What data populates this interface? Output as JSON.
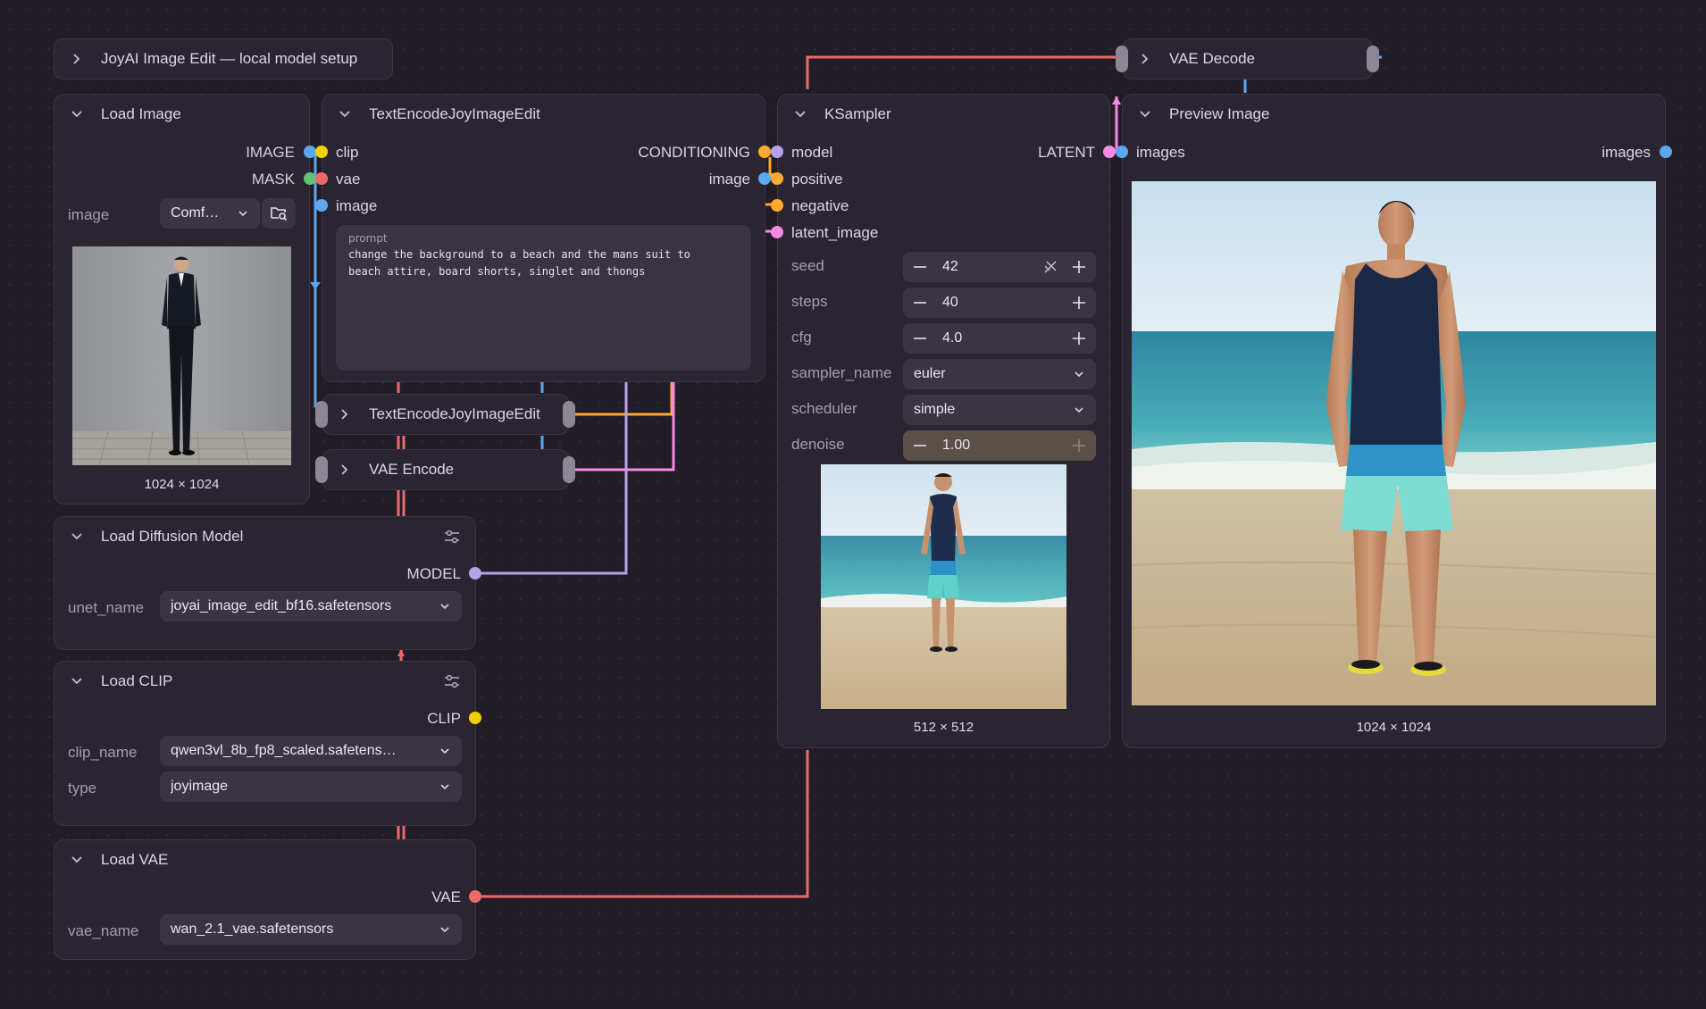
{
  "colors": {
    "background": "#211c26",
    "node_bg": "#2b2532",
    "image": "#5aa8f0",
    "clip": "#f2d000",
    "vae": "#ee6a6a",
    "model": "#b7a2ea",
    "conditioning": "#ffa931",
    "latent": "#f58ae0",
    "mask": "#5ec476"
  },
  "group_node": {
    "title": "JoyAI Image Edit — local model setup"
  },
  "load_image": {
    "title": "Load Image",
    "outputs": [
      "IMAGE",
      "MASK"
    ],
    "widget_label": "image",
    "select_value": "Comf…",
    "folder_icon": "folder-search-icon",
    "preview_caption": "1024 × 1024"
  },
  "text_encode": {
    "title": "TextEncodeJoyImageEdit",
    "inputs": [
      "clip",
      "vae",
      "image"
    ],
    "outputs": [
      "CONDITIONING",
      "image"
    ],
    "prompt_label": "prompt",
    "prompt_text": "change the background to a beach and the mans suit to\nbeach attire, board shorts, singlet and thongs"
  },
  "text_encode_collapsed": {
    "title": "TextEncodeJoyImageEdit"
  },
  "vae_encode": {
    "title": "VAE Encode"
  },
  "vae_decode": {
    "title": "VAE Decode"
  },
  "ksampler": {
    "title": "KSampler",
    "inputs": [
      "model",
      "positive",
      "negative",
      "latent_image"
    ],
    "output": "LATENT",
    "widgets": {
      "seed": {
        "label": "seed",
        "value": "42"
      },
      "steps": {
        "label": "steps",
        "value": "40"
      },
      "cfg": {
        "label": "cfg",
        "value": "4.0"
      },
      "sampler_name": {
        "label": "sampler_name",
        "value": "euler"
      },
      "scheduler": {
        "label": "scheduler",
        "value": "simple"
      },
      "denoise": {
        "label": "denoise",
        "value": "1.00"
      }
    },
    "preview_caption": "512 × 512"
  },
  "preview_image": {
    "title": "Preview Image",
    "input": "images",
    "output": "images",
    "preview_caption": "1024 × 1024"
  },
  "load_diffusion_model": {
    "title": "Load Diffusion Model",
    "output": "MODEL",
    "widget_label": "unet_name",
    "widget_value": "joyai_image_edit_bf16.safetensors"
  },
  "load_clip": {
    "title": "Load CLIP",
    "output": "CLIP",
    "clip_name_label": "clip_name",
    "clip_name_value": "qwen3vl_8b_fp8_scaled.safetens…",
    "type_label": "type",
    "type_value": "joyimage"
  },
  "load_vae": {
    "title": "Load VAE",
    "output": "VAE",
    "widget_label": "vae_name",
    "widget_value": "wan_2.1_vae.safetensors"
  }
}
